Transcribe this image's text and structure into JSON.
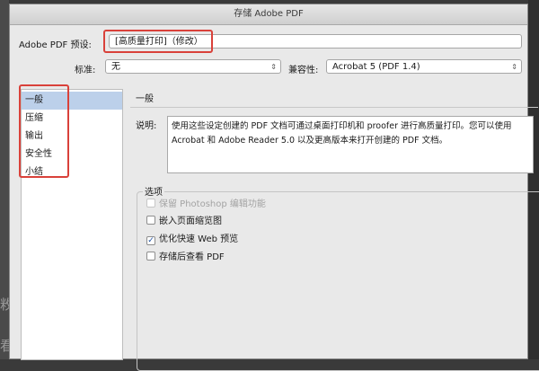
{
  "dialog": {
    "title": "存储 Adobe PDF"
  },
  "preset": {
    "label": "Adobe PDF 预设:",
    "value": "[高质量打印]（修改）"
  },
  "standard": {
    "label": "标准:",
    "value": "无"
  },
  "compat": {
    "label": "兼容性:",
    "value": "Acrobat 5 (PDF 1.4)"
  },
  "sidebar": {
    "items": [
      {
        "label": "一般",
        "selected": true
      },
      {
        "label": "压缩"
      },
      {
        "label": "输出"
      },
      {
        "label": "安全性"
      },
      {
        "label": "小结"
      }
    ]
  },
  "panel": {
    "title": "一般",
    "description_label": "说明:",
    "description": "使用这些设定创建的 PDF 文档可通过桌面打印机和 proofer 进行高质量打印。您可以使用 Acrobat 和 Adobe Reader 5.0 以及更高版本来打开创建的 PDF 文档。"
  },
  "options": {
    "title": "选项",
    "items": [
      {
        "label": "保留 Photoshop 编辑功能",
        "checked": false,
        "disabled": true
      },
      {
        "label": "嵌入页面缩览图",
        "checked": false,
        "disabled": false
      },
      {
        "label": "优化快速 Web 预览",
        "checked": true,
        "disabled": false
      },
      {
        "label": "存储后查看 PDF",
        "checked": false,
        "disabled": false
      }
    ]
  },
  "background": {
    "glyphs": [
      "敉",
      "看"
    ]
  },
  "colors": {
    "annotation_red": "#d9413a",
    "selection": "#bcd0ea"
  }
}
